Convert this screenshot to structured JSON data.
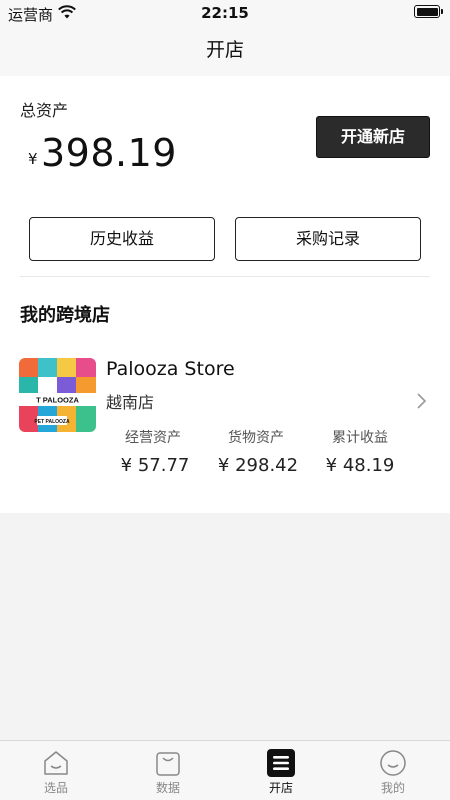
{
  "status_bar": {
    "carrier": "运营商",
    "time": "22:15"
  },
  "nav": {
    "title": "开店"
  },
  "assets": {
    "label": "总资产",
    "currency": "¥",
    "value": "398.19"
  },
  "buttons": {
    "open_store": "开通新店",
    "history_earnings": "历史收益",
    "purchase_records": "采购记录"
  },
  "section": {
    "title": "我的跨境店"
  },
  "store": {
    "name": "Palooza Store",
    "region": "越南店",
    "logo_text_1": "T PALOOZA",
    "logo_text_2": "PET PALOOZA",
    "stats": [
      {
        "label": "经营资产",
        "value": "¥ 57.77"
      },
      {
        "label": "货物资产",
        "value": "¥ 298.42"
      },
      {
        "label": "累计收益",
        "value": "¥ 48.19"
      }
    ]
  },
  "tabs": [
    {
      "label": "选品",
      "icon": "home-icon"
    },
    {
      "label": "数据",
      "icon": "bag-icon"
    },
    {
      "label": "开店",
      "icon": "list-icon",
      "active": true
    },
    {
      "label": "我的",
      "icon": "smile-icon"
    }
  ],
  "colors": {
    "primary_button": "#2b2b2b",
    "background": "#f3f3f3",
    "card": "#ffffff"
  }
}
